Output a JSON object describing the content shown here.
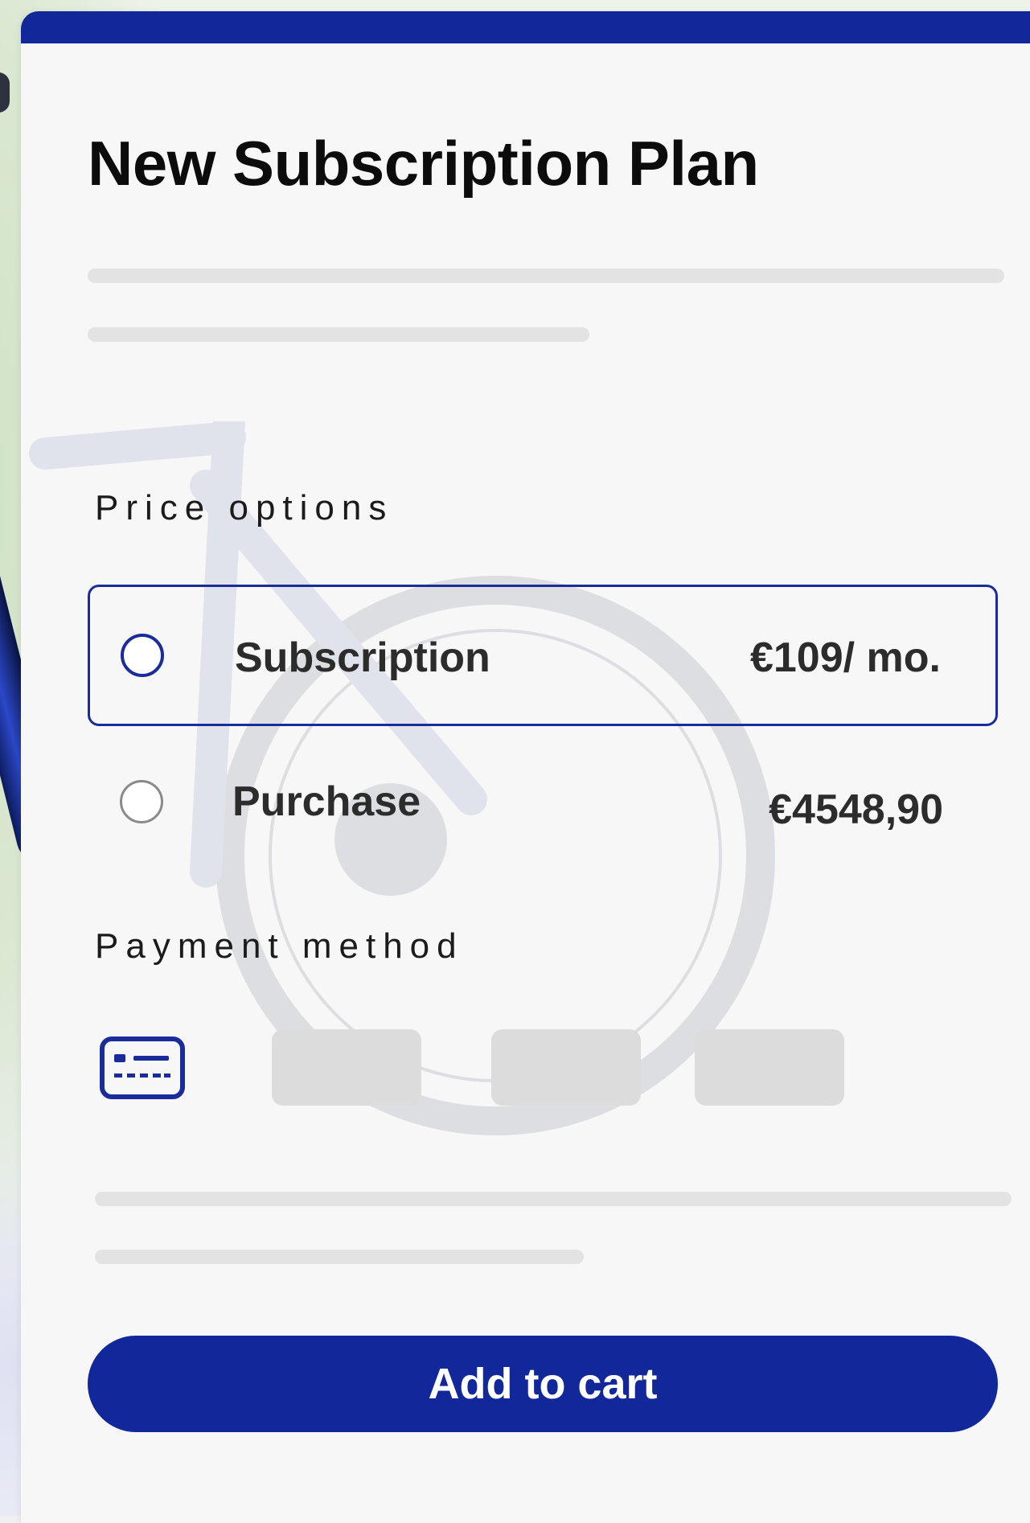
{
  "plan": {
    "title": "New Subscription Plan"
  },
  "price_options": {
    "label": "Price options",
    "options": [
      {
        "label": "Subscription",
        "price": "€109/ mo.",
        "selected": true
      },
      {
        "label": "Purchase",
        "price": "€4548,90",
        "selected": false
      }
    ]
  },
  "payment": {
    "label": "Payment method",
    "icon": "credit-card-icon",
    "placeholders": 3
  },
  "actions": {
    "add_to_cart_label": "Add to cart"
  },
  "colors": {
    "accent": "#12279a",
    "card_background": "#f7f7f7",
    "skeleton": "#e3e3e3",
    "text": "#0c0c0c"
  }
}
